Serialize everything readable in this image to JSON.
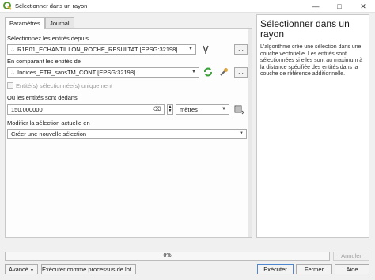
{
  "window": {
    "title": "Sélectionner dans un rayon"
  },
  "tabs": [
    {
      "label": "Paramètres"
    },
    {
      "label": "Journal"
    }
  ],
  "form": {
    "input_layer": {
      "label": "Sélectionnez les entités depuis",
      "value": "R1E01_ECHANTILLON_ROCHE_RESULTAT [EPSG:32198]",
      "browse_label": "..."
    },
    "compare_layer": {
      "label": "En comparant les entités de",
      "value": "Indices_ETR_sansTM_CONT [EPSG:32198]",
      "browse_label": "..."
    },
    "selected_only": {
      "label": "Entité(s) sélectionnée(s) uniquement"
    },
    "distance": {
      "label": "Où les entités sont dedans",
      "value": "150,000000",
      "unit": "mètres"
    },
    "modify": {
      "label": "Modifier la sélection actuelle en",
      "value": "Créer une nouvelle sélection"
    }
  },
  "help": {
    "title": "Sélectionner dans un rayon",
    "text": "L'algorithme crée une sélection dans une couche vectorielle. Les entités sont sélectionnées si elles sont au maximum à la distance spécifiée des entités dans la couche de référence additionnelle."
  },
  "progress": {
    "text": "0%"
  },
  "buttons": {
    "cancel": "Annuler",
    "advanced": "Avancé",
    "batch": "Exécuter comme processus de lot...",
    "run": "Exécuter",
    "close": "Fermer",
    "help": "Aide"
  },
  "colors": {
    "qgis_green": "#589632",
    "accent_blue": "#4f86d0"
  }
}
